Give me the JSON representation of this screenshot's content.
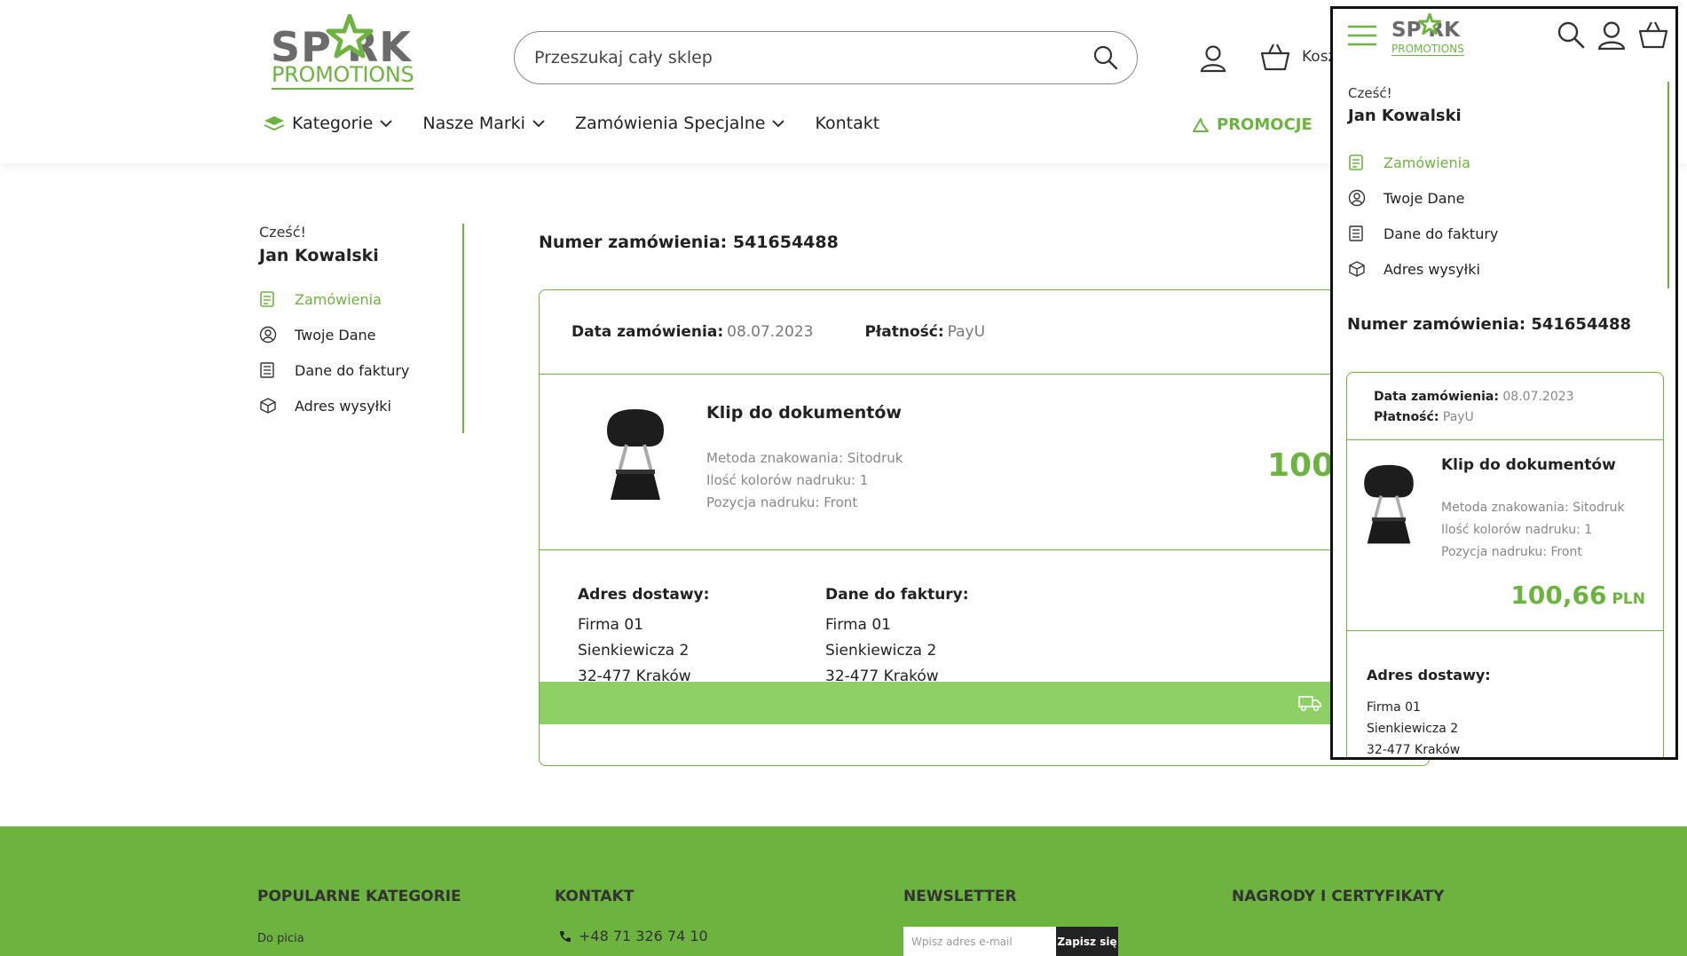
{
  "header": {
    "logo_line1": "SP RK",
    "logo_line2": "PROMOTIONS",
    "search_placeholder": "Przeszukaj cały sklep",
    "basket_label": "Kosz",
    "nav": [
      "Kategorie",
      "Nasze Marki",
      "Zamówienia Specjalne",
      "Kontakt"
    ],
    "promo": "PROMOCJE"
  },
  "sidebar": {
    "greeting": "Cześć!",
    "name": "Jan Kowalski",
    "items": [
      "Zamówienia",
      "Twoje Dane",
      "Dane do faktury",
      "Adres wysyłki"
    ]
  },
  "order": {
    "number_label": "Numer zamówienia: 541654488",
    "date_label": "Data zamówienia:",
    "date_value": "08.07.2023",
    "payment_label": "Płatność:",
    "payment_value": "PayU",
    "product_name": "Klip do dokumentów",
    "spec1": "Metoda znakowania: Sitodruk",
    "spec2": "Ilość kolorów nadruku: 1",
    "spec3": "Pozycja nadruku: Front",
    "price_partial": "100,",
    "delivery_title": "Adres dostawy:",
    "delivery_lines": [
      "Firma 01",
      "Sienkiewicza 2",
      "32-477 Kraków"
    ],
    "invoice_title": "Dane do faktury:",
    "invoice_lines": [
      "Firma 01",
      "Sienkiewicza 2",
      "32-477 Kraków"
    ]
  },
  "footer": {
    "col1": "POPULARNE KATEGORIE",
    "col1_link": "Do picia",
    "col2": "KONTAKT",
    "phone": "+48 71 326 74 10",
    "col3": "NEWSLETTER",
    "email_placeholder": "Wpisz adres e-mail",
    "subscribe": "Zapisz się",
    "col4": "NAGRODY I CERTYFIKATY"
  },
  "mobile": {
    "greeting": "Cześć!",
    "name": "Jan Kowalski",
    "items": [
      "Zamówienia",
      "Twoje Dane",
      "Dane do faktury",
      "Adres wysyłki"
    ],
    "order_number": "Numer zamówienia: 541654488",
    "date_label": "Data zamówienia:",
    "date_value": "08.07.2023",
    "payment_label": "Płatność:",
    "payment_value": "PayU",
    "product_name": "Klip do dokumentów",
    "spec1": "Metoda znakowania: Sitodruk",
    "spec2": "Ilość kolorów nadruku: 1",
    "spec3": "Pozycja nadruku: Front",
    "price": "100,66",
    "currency": "PLN",
    "delivery_title": "Adres dostawy:",
    "delivery_lines": [
      "Firma 01",
      "Sienkiewicza 2",
      "32-477 Kraków"
    ]
  },
  "colors": {
    "accent": "#6cb33f",
    "accent_light": "#8fd064"
  }
}
